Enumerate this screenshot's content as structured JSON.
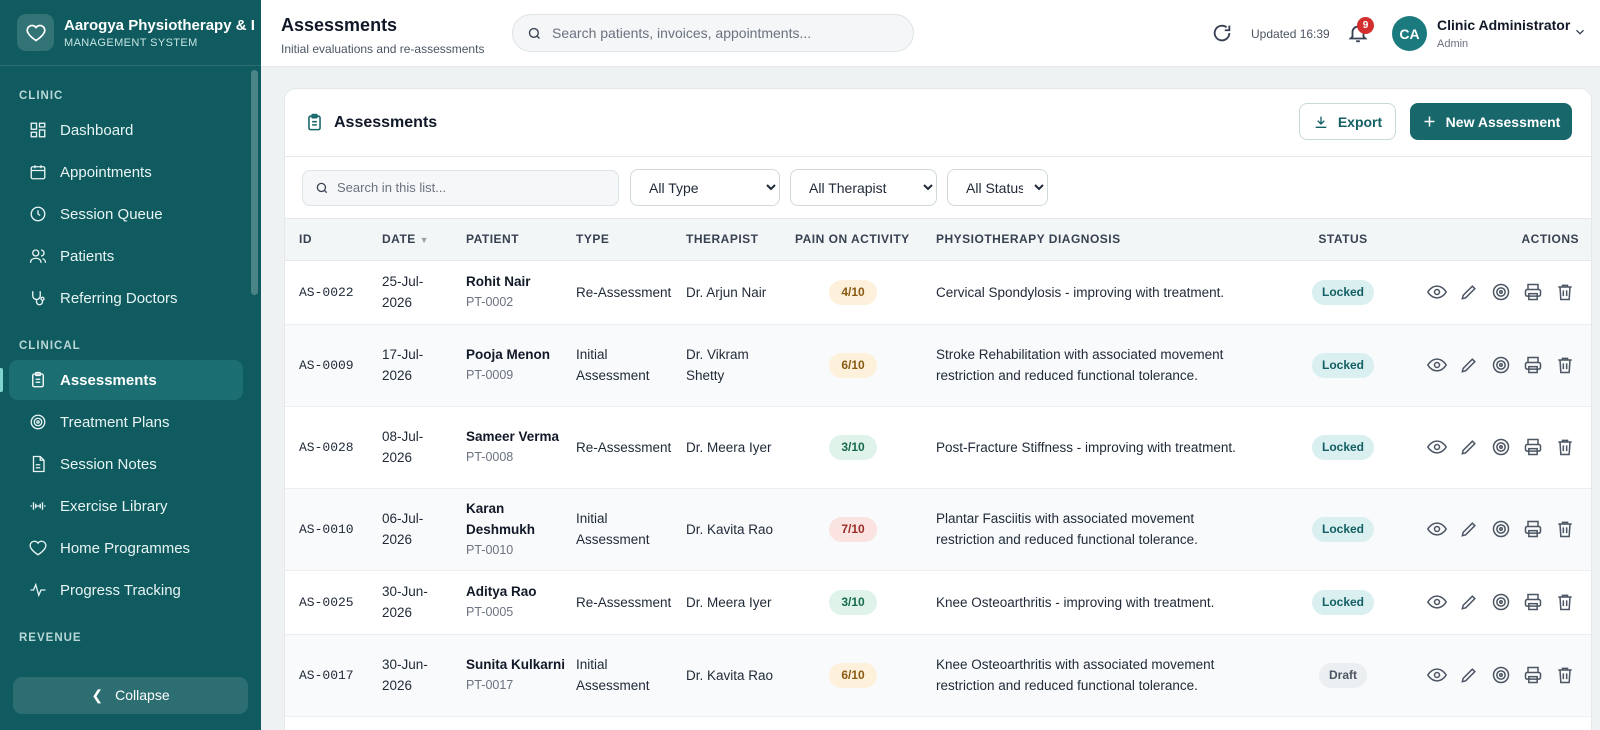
{
  "brand": {
    "name": "Aarogya Physiotherapy & I",
    "subtitle": "MANAGEMENT SYSTEM"
  },
  "sidebar": {
    "sections": [
      {
        "label": "CLINIC",
        "items": [
          {
            "label": "Dashboard",
            "icon": "grid-icon"
          },
          {
            "label": "Appointments",
            "icon": "calendar-icon"
          },
          {
            "label": "Session Queue",
            "icon": "clock-icon"
          },
          {
            "label": "Patients",
            "icon": "users-icon"
          },
          {
            "label": "Referring Doctors",
            "icon": "stethoscope-icon"
          }
        ]
      },
      {
        "label": "CLINICAL",
        "items": [
          {
            "label": "Assessments",
            "icon": "clipboard-icon",
            "active": true
          },
          {
            "label": "Treatment Plans",
            "icon": "target-icon"
          },
          {
            "label": "Session Notes",
            "icon": "file-icon"
          },
          {
            "label": "Exercise Library",
            "icon": "dumbbell-icon"
          },
          {
            "label": "Home Programmes",
            "icon": "heart-icon"
          },
          {
            "label": "Progress Tracking",
            "icon": "activity-icon"
          }
        ]
      },
      {
        "label": "REVENUE",
        "items": []
      }
    ],
    "collapse_label": "Collapse"
  },
  "topbar": {
    "title": "Assessments",
    "subtitle": "Initial evaluations and re-assessments",
    "search_placeholder": "Search patients, invoices, appointments...",
    "updated": "Updated 16:39",
    "notification_count": "9",
    "user": {
      "initials": "CA",
      "name": "Clinic Administrator",
      "role": "Admin"
    }
  },
  "card": {
    "title": "Assessments",
    "export_label": "Export",
    "new_label": "New Assessment",
    "filters": {
      "search_placeholder": "Search in this list...",
      "type": "All Type",
      "therapist": "All Therapist",
      "status": "All Status"
    },
    "columns": {
      "id": "ID",
      "date": "DATE",
      "patient": "PATIENT",
      "type": "TYPE",
      "therapist": "THERAPIST",
      "pain": "PAIN ON ACTIVITY",
      "diagnosis": "PHYSIOTHERAPY DIAGNOSIS",
      "status": "STATUS",
      "actions": "ACTIONS"
    },
    "rows": [
      {
        "id": "AS-0022",
        "date": "25-Jul-2026",
        "patient": "Rohit Nair",
        "pid": "PT-0002",
        "type": "Re-Assessment",
        "therapist": "Dr. Arjun Nair",
        "pain": "4/10",
        "pain_level": "amber",
        "diagnosis": "Cervical Spondylosis - improving with treatment.",
        "status": "Locked"
      },
      {
        "id": "AS-0009",
        "date": "17-Jul-2026",
        "patient": "Pooja Menon",
        "pid": "PT-0009",
        "type": "Initial Assessment",
        "therapist": "Dr. Vikram Shetty",
        "pain": "6/10",
        "pain_level": "amber",
        "diagnosis": "Stroke Rehabilitation with associated movement restriction and reduced functional tolerance.",
        "status": "Locked"
      },
      {
        "id": "AS-0028",
        "date": "08-Jul-2026",
        "patient": "Sameer Verma",
        "pid": "PT-0008",
        "type": "Re-Assessment",
        "therapist": "Dr. Meera Iyer",
        "pain": "3/10",
        "pain_level": "green",
        "diagnosis": "Post-Fracture Stiffness - improving with treatment.",
        "status": "Locked"
      },
      {
        "id": "AS-0010",
        "date": "06-Jul-2026",
        "patient": "Karan Deshmukh",
        "pid": "PT-0010",
        "type": "Initial Assessment",
        "therapist": "Dr. Kavita Rao",
        "pain": "7/10",
        "pain_level": "red",
        "diagnosis": "Plantar Fasciitis with associated movement restriction and reduced functional tolerance.",
        "status": "Locked"
      },
      {
        "id": "AS-0025",
        "date": "30-Jun-2026",
        "patient": "Aditya Rao",
        "pid": "PT-0005",
        "type": "Re-Assessment",
        "therapist": "Dr. Meera Iyer",
        "pain": "3/10",
        "pain_level": "green",
        "diagnosis": "Knee Osteoarthritis - improving with treatment.",
        "status": "Locked"
      },
      {
        "id": "AS-0017",
        "date": "30-Jun-2026",
        "patient": "Sunita Kulkarni",
        "pid": "PT-0017",
        "type": "Initial Assessment",
        "therapist": "Dr. Kavita Rao",
        "pain": "6/10",
        "pain_level": "amber",
        "diagnosis": "Knee Osteoarthritis with associated movement restriction and reduced functional tolerance.",
        "status": "Draft"
      }
    ]
  },
  "colors": {
    "sidebar": "#0f5b5f",
    "accent": "#17676b",
    "locked": "#d9eff0",
    "badge": "#d32f2f"
  }
}
